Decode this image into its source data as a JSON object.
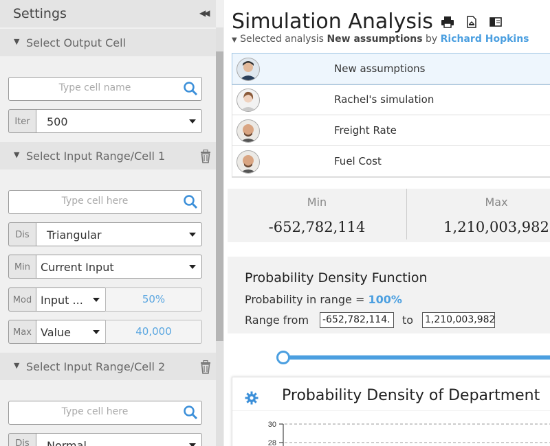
{
  "sidebar": {
    "title": "Settings",
    "output_section": {
      "label": "Select Output Cell",
      "cell_placeholder": "Type cell name",
      "iter_tag": "Iter",
      "iter_value": "500"
    },
    "input_section_1": {
      "label": "Select Input Range/Cell 1",
      "cell_placeholder": "Type cell here",
      "dist_tag": "Dis",
      "dist_value": "Triangular",
      "min_tag": "Min",
      "min_value": "Current Input",
      "mod_tag": "Mod",
      "mod_value": "Input ...",
      "mod_pct": "50%",
      "max_tag": "Max",
      "max_value": "Value",
      "max_amount": "40,000"
    },
    "input_section_2": {
      "label": "Select Input Range/Cell 2",
      "cell_placeholder": "Type cell here",
      "dist_tag": "Dis",
      "dist_value": "Normal"
    }
  },
  "main": {
    "title": "Simulation Analysis",
    "subtitle_prefix": "Selected analysis",
    "subtitle_analysis": "New assumptions",
    "subtitle_by": "by",
    "subtitle_author": "Richard Hopkins",
    "analyses": [
      {
        "name": "New assumptions",
        "selected": true
      },
      {
        "name": "Rachel's simulation",
        "selected": false
      },
      {
        "name": "Freight Rate",
        "selected": false
      },
      {
        "name": "Fuel Cost",
        "selected": false
      }
    ],
    "stats": {
      "min_label": "Min",
      "min_value": "-652,782,114",
      "max_label": "Max",
      "max_value": "1,210,003,982"
    },
    "pdf": {
      "title": "Probability Density Function",
      "prob_label": "Probability in range =",
      "prob_value": "100%",
      "range_from_label": "Range from",
      "range_from_value": "-652,782,114.",
      "range_to_label": "to",
      "range_to_value": "1,210,003,982"
    },
    "slider_position": 0,
    "chart_title": "Probability Density of Department",
    "chart_ticks": [
      "30",
      "28"
    ]
  },
  "colors": {
    "accent": "#4b9fe0",
    "sidebar_bg": "#f0f0f0",
    "section_bg": "#e4e4e4"
  }
}
